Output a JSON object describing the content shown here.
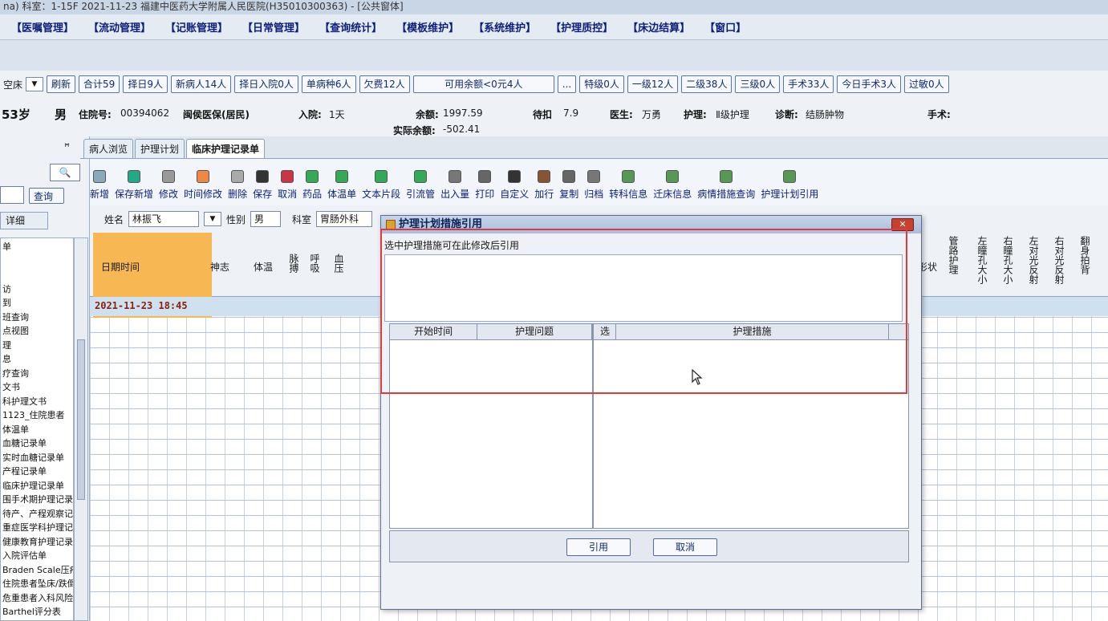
{
  "window": {
    "title": "na) 科室：1-15F 2021-11-23 福建中医药大学附属人民医院(H35010300363) - [公共窗体]"
  },
  "menu": [
    "【医嘱管理】",
    "【流动管理】",
    "【记账管理】",
    "【日常管理】",
    "【查询统计】",
    "【模板维护】",
    "【系统维护】",
    "【护理质控】",
    "【床边结算】",
    "【窗口】"
  ],
  "filter": {
    "bed_select": "空床",
    "buttons": [
      "刷新",
      "合计59",
      "择日9人",
      "新病人14人",
      "择日入院0人",
      "单病种6人",
      "欠费12人"
    ],
    "balance_button": "可用余额<0元4人",
    "more_button": "...",
    "levels": [
      "特级0人",
      "一级12人",
      "二级38人",
      "三级0人",
      "手术33人",
      "今日手术3人",
      "过敏0人"
    ]
  },
  "patient": {
    "age": "53岁",
    "sex": "男",
    "inpatient_label": "住院号:",
    "inpatient_no": "00394062",
    "insurance": "闽侯医保(居民)",
    "admit_label": "入院:",
    "admit_value": "1天",
    "balance_label": "余额:",
    "balance_value": "1997.59",
    "actual_label": "实际余额:",
    "actual_value": "-502.41",
    "pending_label": "待扣",
    "pending_value": "7.9",
    "doctor_label": "医生:",
    "doctor_value": "万勇",
    "nursing_label": "护理:",
    "nursing_value": "Ⅱ级护理",
    "diag_label": "诊断:",
    "diag_value": "结肠肿物",
    "surgery_label": "手术:"
  },
  "side": {
    "pin": "ꟸ",
    "search_button": "查询",
    "detail_tab": "详细",
    "items": [
      "单",
      "",
      "",
      "访",
      "到",
      "班查询",
      "点视图",
      "理",
      "息",
      "疗查询",
      "文书",
      "科护理文书",
      "1123_住院患者",
      "体温单",
      "血糖记录单",
      "实时血糖记录单",
      "产程记录单",
      "临床护理记录单",
      "围手术期护理记录",
      "待产、产程观察记",
      "重症医学科护理记",
      "健康教育护理记录",
      "入院评估单",
      "Braden Scale压疮",
      "住院患者坠床/跌倒",
      "危重患者入科风险",
      "Barthel评分表"
    ]
  },
  "tabs": [
    "病人浏览",
    "护理计划",
    "临床护理记录单"
  ],
  "toolbar": [
    "新增",
    "保存新增",
    "修改",
    "时间修改",
    "删除",
    "保存",
    "取消",
    "药品",
    "体温单",
    "文本片段",
    "引流管",
    "出入量",
    "打印",
    "自定义",
    "加行",
    "复制",
    "归档",
    "转科信息",
    "迁床信息",
    "病情措施查询",
    "护理计划引用"
  ],
  "form": {
    "name_label": "姓名",
    "name_value": "林振飞",
    "sex_label": "性别",
    "sex_value": "男",
    "dept_label": "科室",
    "dept_value": "胃肠外科"
  },
  "grid": {
    "headers": [
      "日期时间",
      "神志",
      "体温",
      "脉搏",
      "呼吸",
      "血压"
    ],
    "right_headers": [
      "形状",
      "管路护理",
      "左瞳孔大小",
      "右瞳孔大小",
      "左对光反射",
      "右对光反射",
      "翻身拍背"
    ],
    "first_row": "2021-11-23 18:45"
  },
  "dialog": {
    "title": "护理计划措施引用",
    "tip": "选中护理措施可在此修改后引用",
    "left_headers": [
      "开始时间",
      "护理问题"
    ],
    "right_headers": [
      "选",
      "护理措施"
    ],
    "ok": "引用",
    "cancel": "取消",
    "close": "✕"
  }
}
